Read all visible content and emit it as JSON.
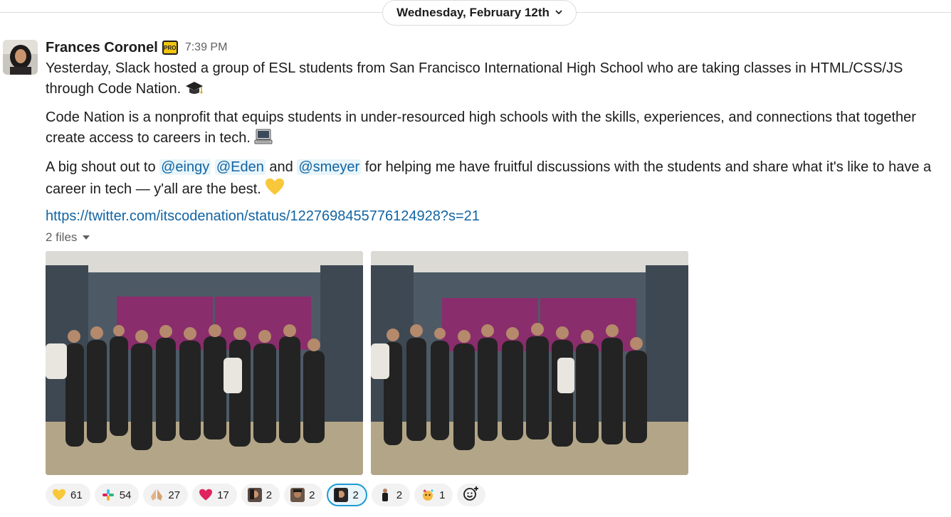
{
  "date_divider": {
    "label": "Wednesday, February 12th"
  },
  "message": {
    "sender": "Frances Coronel",
    "badge": "PRO",
    "time": "7:39 PM",
    "p1": "Yesterday, Slack hosted a group of ESL students from San Francisco International High School who are taking classes in HTML/CSS/JS through Code Nation.",
    "p2": "Code Nation is a nonprofit that equips students in under-resourced high schools with the skills, experiences, and connections that together create access to careers in tech.",
    "p3_before": "A big shout out to",
    "mention_1": "@eingy",
    "mention_2": "@Eden",
    "p3_and": "and",
    "mention_3": "@smeyer",
    "p3_after": "for helping me have fruitful discussions with the students and share what it's like to have a career in tech — y'all are the best.",
    "link": "https://twitter.com/itscodenation/status/1227698455776124928?s=21",
    "files_label": "2 files",
    "emoji": {
      "p1": "graduation-cap-icon",
      "p2": "computer-icon",
      "p3": "yellow-heart-icon"
    }
  },
  "reactions": [
    {
      "icon": "yellow-heart-icon",
      "count": "61"
    },
    {
      "icon": "slack-logo-icon",
      "count": "54"
    },
    {
      "icon": "folded-hands-icon",
      "count": "27"
    },
    {
      "icon": "red-heart-icon",
      "count": "17"
    },
    {
      "icon": "custom-face-icon",
      "count": "2"
    },
    {
      "icon": "custom-face-icon",
      "count": "2"
    },
    {
      "icon": "custom-face-icon",
      "count": "2",
      "active": true
    },
    {
      "icon": "custom-figure-icon",
      "count": "2"
    },
    {
      "icon": "custom-party-icon",
      "count": "1"
    }
  ],
  "colors": {
    "link": "#1264a3",
    "mention_bg": "#e8f5fa",
    "active_reaction_border": "#1d9bd1",
    "reaction_bg": "#f2f2f2"
  }
}
